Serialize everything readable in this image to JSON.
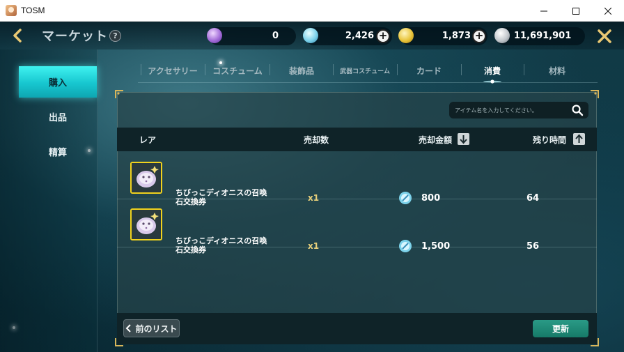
{
  "window": {
    "title": "TOSM",
    "controls": [
      "minimize",
      "maximize",
      "close"
    ]
  },
  "header": {
    "title": "マーケット",
    "help_glyph": "?",
    "currencies": [
      {
        "icon": "purple-crystal-icon",
        "value": "0",
        "has_plus": false
      },
      {
        "icon": "blue-gem-icon",
        "value": "2,426",
        "has_plus": true
      },
      {
        "icon": "gold-coin-icon",
        "value": "1,873",
        "has_plus": true
      },
      {
        "icon": "silver-coin-icon",
        "value": "11,691,901",
        "has_plus": false
      }
    ],
    "plus_glyph": "+"
  },
  "sidebar": {
    "items": [
      {
        "label": "購入",
        "active": true
      },
      {
        "label": "出品",
        "active": false
      },
      {
        "label": "精算",
        "active": false
      }
    ]
  },
  "tabs": [
    {
      "label": "アクセサリー",
      "active": false
    },
    {
      "label": "コスチューム",
      "active": false
    },
    {
      "label": "装飾品",
      "active": false
    },
    {
      "label": "武器コスチューム",
      "active": false
    },
    {
      "label": "カード",
      "active": false
    },
    {
      "label": "消費",
      "active": true
    },
    {
      "label": "材料",
      "active": false
    }
  ],
  "search": {
    "placeholder": "アイテム名を入力してください。",
    "icon": "search-icon"
  },
  "table": {
    "headers": {
      "rarity": "レア",
      "quantity": "売却数",
      "price": "売却金額",
      "time": "残り時間"
    },
    "price_sort": "descending",
    "time_sort": "ascending",
    "rows": [
      {
        "name_line1": "ちびっこディオニスの召喚",
        "name_line2": "石交換券",
        "quantity": "x1",
        "price": "800",
        "time": "64"
      },
      {
        "name_line1": "ちびっこディオニスの召喚",
        "name_line2": "石交換券",
        "quantity": "x1",
        "price": "1,500",
        "time": "56"
      }
    ]
  },
  "footer": {
    "prev_label": "前のリスト",
    "refresh_label": "更新"
  },
  "colors": {
    "accent_cyan": "#17c6cf",
    "item_border_gold": "#f1d21d",
    "refresh_green": "#1e8a75"
  }
}
